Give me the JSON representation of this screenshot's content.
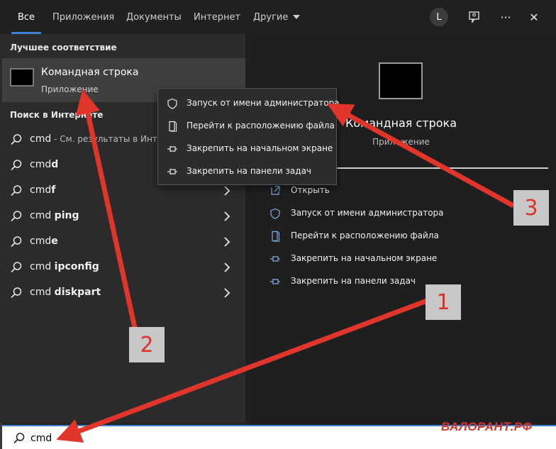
{
  "tabs": [
    {
      "label": "Все",
      "active": true
    },
    {
      "label": "Приложения"
    },
    {
      "label": "Документы"
    },
    {
      "label": "Интернет"
    },
    {
      "label": "Другие"
    }
  ],
  "header": {
    "avatar_letter": "L",
    "more_label": "···",
    "close_label": "✕"
  },
  "left": {
    "best_match_title": "Лучшее соответствие",
    "best_match": {
      "title": "Командная строка",
      "subtitle": "Приложение"
    },
    "web_title": "Поиск в Интернете",
    "suggestions": [
      {
        "bold": "cmd",
        "rest": " - См. результаты в Интер"
      },
      {
        "plain": "cmd",
        "bold": "d"
      },
      {
        "plain": "cmd",
        "bold": "f"
      },
      {
        "plain": "cmd ",
        "bold": "ping"
      },
      {
        "plain": "cmd",
        "bold": "e"
      },
      {
        "plain": "cmd ",
        "bold": "ipconfig"
      },
      {
        "plain": "cmd ",
        "bold": "diskpart"
      }
    ]
  },
  "right": {
    "title": "Командная строка",
    "subtitle": "Приложение",
    "actions": [
      {
        "label": "Открыть",
        "icon": "open-icon"
      },
      {
        "label": "Запуск от имени администратора",
        "icon": "shield-icon"
      },
      {
        "label": "Перейти к расположению файла",
        "icon": "file-location-icon"
      },
      {
        "label": "Закрепить на начальном экране",
        "icon": "pin-icon"
      },
      {
        "label": "Закрепить на панели задач",
        "icon": "pin-icon"
      }
    ]
  },
  "context_menu": [
    {
      "label": "Запуск от имени администратора",
      "icon": "shield-icon"
    },
    {
      "label": "Перейти к расположению файла",
      "icon": "file-location-icon"
    },
    {
      "label": "Закрепить на начальном экране",
      "icon": "pin-icon"
    },
    {
      "label": "Закрепить на панели задач",
      "icon": "pin-icon"
    }
  ],
  "search": {
    "value": "cmd"
  },
  "watermark": "ВАЛОРАНТ.РФ",
  "annotations": [
    {
      "number": "1"
    },
    {
      "number": "2"
    },
    {
      "number": "3"
    }
  ],
  "colors": {
    "accent": "#3b82d6",
    "arrow": "#e0352b",
    "annotation_box": "#c8c8c8"
  }
}
